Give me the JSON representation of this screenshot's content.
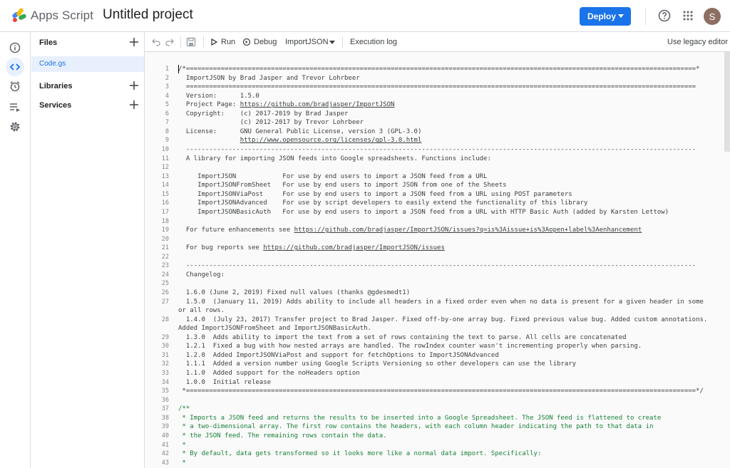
{
  "header": {
    "app_name": "Apps Script",
    "project_title": "Untitled project",
    "deploy_label": "Deploy",
    "avatar_letter": "S",
    "accent": "#1a73e8"
  },
  "rail": {
    "items": [
      {
        "name": "overview",
        "icon": "info-icon"
      },
      {
        "name": "editor",
        "icon": "code-icon",
        "active": true
      },
      {
        "name": "triggers",
        "icon": "alarm-icon"
      },
      {
        "name": "executions",
        "icon": "executions-icon"
      },
      {
        "name": "settings",
        "icon": "gear-icon"
      }
    ]
  },
  "files_panel": {
    "files_label": "Files",
    "files": [
      "Code.gs"
    ],
    "libraries_label": "Libraries",
    "services_label": "Services"
  },
  "toolbar": {
    "run_label": "Run",
    "debug_label": "Debug",
    "function_select": "ImportJSON",
    "execution_log_label": "Execution log",
    "legacy_label": "Use legacy editor"
  },
  "editor": {
    "lines": [
      {
        "n": "1",
        "text": "/*====================================================================================================================================*"
      },
      {
        "n": "2",
        "text": "  ImportJSON by Brad Jasper and Trevor Lohrbeer"
      },
      {
        "n": "3",
        "text": "  ===================================================================================================================================="
      },
      {
        "n": "4",
        "text": "  Version:      1.5.0"
      },
      {
        "n": "5",
        "text": "  Project Page: ",
        "link": "https://github.com/bradjasper/ImportJSON"
      },
      {
        "n": "6",
        "text": "  Copyright:    (c) 2017-2019 by Brad Jasper"
      },
      {
        "n": "7",
        "text": "                (c) 2012-2017 by Trevor Lohrbeer"
      },
      {
        "n": "8",
        "text": "  License:      GNU General Public License, version 3 (GPL-3.0)"
      },
      {
        "n": "9",
        "text": "                ",
        "link": "http://www.opensource.org/licenses/gpl-3.0.html"
      },
      {
        "n": "10",
        "text": "  ------------------------------------------------------------------------------------------------------------------------------------"
      },
      {
        "n": "11",
        "text": "  A library for importing JSON feeds into Google spreadsheets. Functions include:"
      },
      {
        "n": "12",
        "text": ""
      },
      {
        "n": "13",
        "text": "     ImportJSON            For use by end users to import a JSON feed from a URL"
      },
      {
        "n": "14",
        "text": "     ImportJSONFromSheet   For use by end users to import JSON from one of the Sheets"
      },
      {
        "n": "15",
        "text": "     ImportJSONViaPost     For use by end users to import a JSON feed from a URL using POST parameters"
      },
      {
        "n": "16",
        "text": "     ImportJSONAdvanced    For use by script developers to easily extend the functionality of this library"
      },
      {
        "n": "17",
        "text": "     ImportJSONBasicAuth   For use by end users to import a JSON feed from a URL with HTTP Basic Auth (added by Karsten Lettow)"
      },
      {
        "n": "18",
        "text": ""
      },
      {
        "n": "19",
        "text": "  For future enhancements see ",
        "link": "https://github.com/bradjasper/ImportJSON/issues?q=is%3Aissue+is%3Aopen+label%3Aenhancement"
      },
      {
        "n": "20",
        "text": ""
      },
      {
        "n": "21",
        "text": "  For bug reports see ",
        "link": "https://github.com/bradjasper/ImportJSON/issues"
      },
      {
        "n": "22",
        "text": ""
      },
      {
        "n": "23",
        "text": "  ------------------------------------------------------------------------------------------------------------------------------------"
      },
      {
        "n": "24",
        "text": "  Changelog:"
      },
      {
        "n": "25",
        "text": ""
      },
      {
        "n": "26",
        "text": "  1.6.0 (June 2, 2019) Fixed null values (thanks @gdesmedt1)"
      },
      {
        "n": "27",
        "text": "  1.5.0  (January 11, 2019) Adds ability to include all headers in a fixed order even when no data is present for a given header in some or all rows.",
        "wrap": true
      },
      {
        "n": "28",
        "text": "  1.4.0  (July 23, 2017) Transfer project to Brad Jasper. Fixed off-by-one array bug. Fixed previous value bug. Added custom annotations. Added ImportJSONFromSheet and ImportJSONBasicAuth.",
        "wrap": true
      },
      {
        "n": "29",
        "text": "  1.3.0  Adds ability to import the text from a set of rows containing the text to parse. All cells are concatenated"
      },
      {
        "n": "30",
        "text": "  1.2.1  Fixed a bug with how nested arrays are handled. The rowIndex counter wasn't incrementing properly when parsing."
      },
      {
        "n": "31",
        "text": "  1.2.0  Added ImportJSONViaPost and support for fetchOptions to ImportJSONAdvanced"
      },
      {
        "n": "32",
        "text": "  1.1.1  Added a version number using Google Scripts Versioning so other developers can use the library"
      },
      {
        "n": "33",
        "text": "  1.1.0  Added support for the noHeaders option"
      },
      {
        "n": "34",
        "text": "  1.0.0  Initial release"
      },
      {
        "n": "35",
        "text": " *====================================================================================================================================*/"
      },
      {
        "n": "36",
        "text": ""
      },
      {
        "n": "37",
        "text": "/**",
        "green": true
      },
      {
        "n": "38",
        "text": " * Imports a JSON feed and returns the results to be inserted into a Google Spreadsheet. The JSON feed is flattened to create",
        "green": true
      },
      {
        "n": "39",
        "text": " * a two-dimensional array. The first row contains the headers, with each column header indicating the path to that data in",
        "green": true
      },
      {
        "n": "40",
        "text": " * the JSON feed. The remaining rows contain the data.",
        "green": true
      },
      {
        "n": "41",
        "text": " *",
        "green": true
      },
      {
        "n": "42",
        "text": " * By default, data gets transformed so it looks more like a normal data import. Specifically:",
        "green": true
      },
      {
        "n": "43",
        "text": " *",
        "green": true
      }
    ]
  }
}
